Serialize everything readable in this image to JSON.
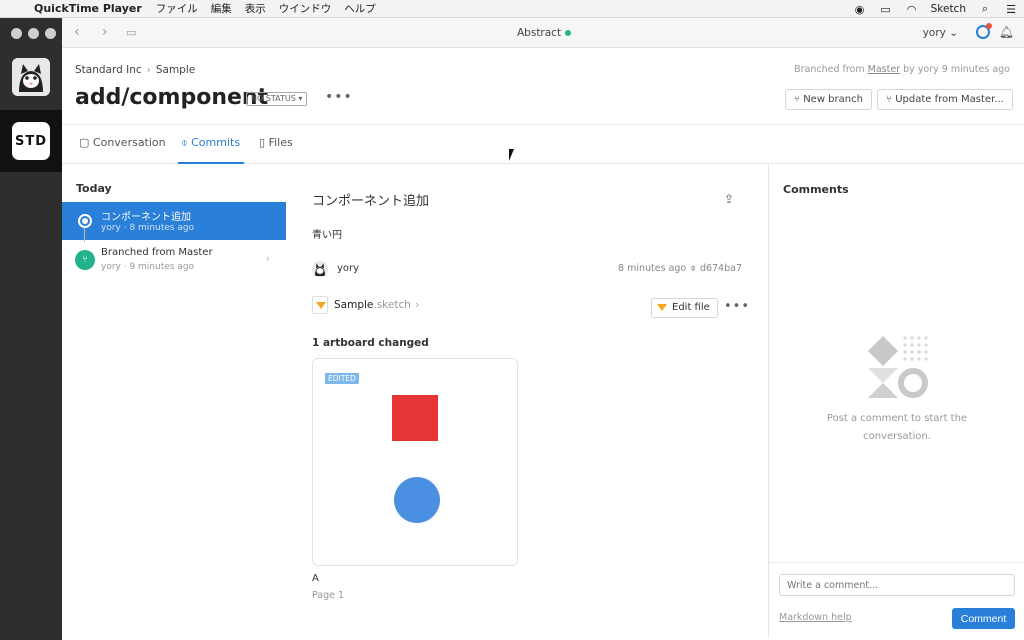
{
  "menubar": {
    "app_name": "QuickTime Player",
    "items": [
      "ファイル",
      "編集",
      "表示",
      "ウインドウ",
      "ヘルプ"
    ],
    "sketch": "Sketch"
  },
  "toolbar": {
    "title": "Abstract",
    "user": "yory"
  },
  "rail": {
    "workspace": "STD"
  },
  "header": {
    "breadcrumb": [
      "Standard Inc",
      "Sample"
    ],
    "branched_prefix": "Branched from",
    "branched_link": "Master",
    "branched_suffix": "by yory 9 minutes ago",
    "title": "add/component",
    "status": "NO STATUS",
    "new_branch": "New branch",
    "update": "Update from Master..."
  },
  "tabs": [
    "Conversation",
    "Commits",
    "Files"
  ],
  "commits": {
    "group": "Today",
    "items": [
      {
        "title": "コンポーネント追加",
        "sub": "yory · 8 minutes ago"
      },
      {
        "title": "Branched from Master",
        "sub": "yory · 9 minutes ago"
      }
    ]
  },
  "detail": {
    "title": "コンポーネント追加",
    "description": "青い円",
    "author": "yory",
    "time": "8 minutes ago",
    "hash": "d674ba7",
    "file_name": "Sample",
    "file_ext": ".sketch",
    "edit_file": "Edit file",
    "changed": "1 artboard changed",
    "edited_badge": "EDITED",
    "artboard": "A",
    "page": "Page 1",
    "shape_colors": {
      "square": "#e53535",
      "circle": "#4a8fe2"
    }
  },
  "comments": {
    "title": "Comments",
    "empty": "Post a comment to start the conversation.",
    "placeholder": "Write a comment...",
    "markdown_help": "Markdown help",
    "button": "Comment"
  },
  "colors": {
    "accent": "#2a7fd8",
    "branch": "#22b38a",
    "status_dot": "#29b87a"
  }
}
